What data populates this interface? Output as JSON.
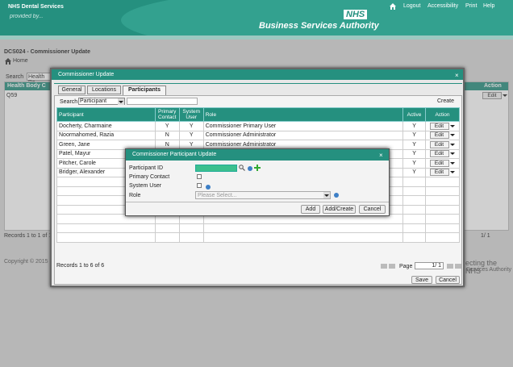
{
  "header": {
    "brand": "NHS Dental Services",
    "tagline": "provided by...",
    "nhs": "NHS",
    "authority": "Business Services Authority",
    "links": [
      "Logout",
      "Accessibility",
      "Print",
      "Help"
    ]
  },
  "page": {
    "title": "DCS024 - Commissioner Update",
    "home": "Home",
    "search_label": "Search",
    "search_value": "Health Bo",
    "grid_header": "Health Body C",
    "action_header": "Action",
    "row_value": "Q59",
    "edit": "Edit",
    "records": "Records 1 to 1 of 1",
    "pager": "1/ 1",
    "copyright": "Copyright © 2015 N",
    "footer1": "ecting the NHS",
    "footer2": "Services Authority"
  },
  "modal": {
    "title": "Commissioner Update",
    "tabs": [
      "General",
      "Locations",
      "Participants"
    ],
    "search_label": "Search",
    "search_select": "Participant",
    "create": "Create",
    "columns": [
      "Participant",
      "Primary Contact",
      "System User",
      "Role",
      "Active",
      "Action"
    ],
    "rows": [
      {
        "name": "Docherty, Charmaine",
        "primary": "Y",
        "system": "Y",
        "role": "Commissioner Primary User",
        "active": "Y"
      },
      {
        "name": "Noormahomed, Razia",
        "primary": "N",
        "system": "Y",
        "role": "Commissioner Administrator",
        "active": "Y"
      },
      {
        "name": "Green, Jane",
        "primary": "N",
        "system": "Y",
        "role": "Commissioner Administrator",
        "active": "Y"
      },
      {
        "name": "Patel, Mayur",
        "primary": "",
        "system": "",
        "role": "",
        "active": "Y"
      },
      {
        "name": "Pitcher, Carole",
        "primary": "",
        "system": "",
        "role": "",
        "active": "Y"
      },
      {
        "name": "Bridger, Alexander",
        "primary": "",
        "system": "",
        "role": "",
        "active": "Y"
      }
    ],
    "edit": "Edit",
    "records": "Records 1 to 6 of 6",
    "page_label": "Page",
    "page_value": "1/ 1",
    "save": "Save",
    "cancel": "Cancel"
  },
  "dialog": {
    "title": "Commissioner Participant Update",
    "participant_id": "Participant ID",
    "primary_contact": "Primary Contact",
    "system_user": "System User",
    "role": "Role",
    "role_placeholder": "Please Select...",
    "add": "Add",
    "add_create": "Add/Create",
    "cancel": "Cancel"
  },
  "colors": {
    "teal": "#25907f",
    "green_input": "#3cc08e"
  }
}
